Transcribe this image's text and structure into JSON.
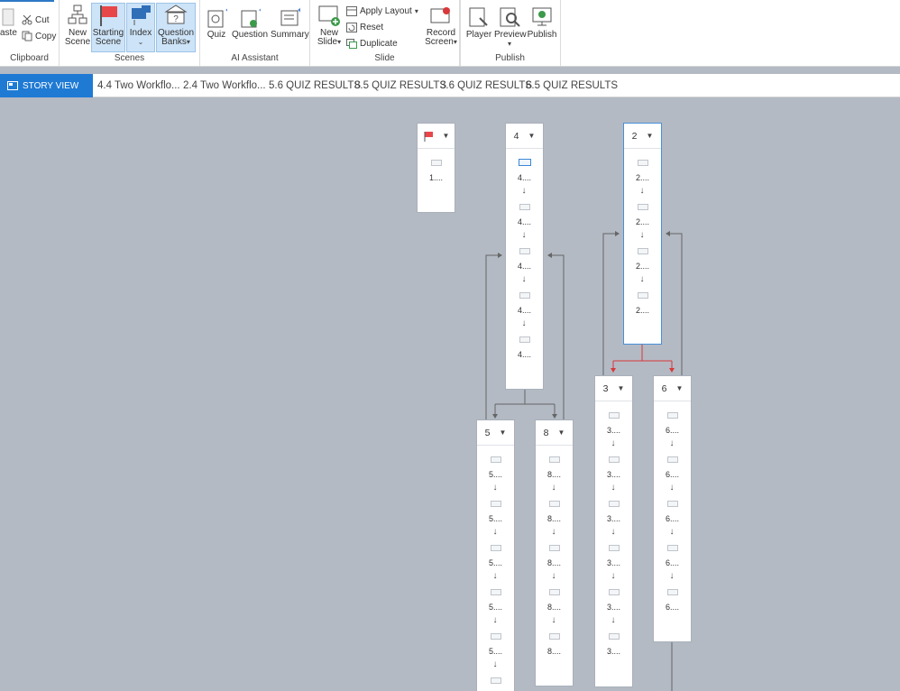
{
  "ribbon": {
    "clipboard": {
      "paste": "aste",
      "cut": "Cut",
      "copy": "Copy",
      "label": "Clipboard"
    },
    "scenes": {
      "new_scene": [
        "New",
        "Scene"
      ],
      "starting_scene": [
        "Starting",
        "Scene"
      ],
      "index": "Index",
      "question_banks": [
        "Question",
        "Banks"
      ],
      "label": "Scenes"
    },
    "ai": {
      "quiz": "Quiz",
      "question": "Question",
      "summary": "Summary",
      "label": "AI Assistant"
    },
    "slide": {
      "new_slide": [
        "New",
        "Slide"
      ],
      "apply_layout": "Apply Layout",
      "reset": "Reset",
      "duplicate": "Duplicate",
      "label": "Slide"
    },
    "record": [
      "Record",
      "Screen"
    ],
    "publish": {
      "player": "Player",
      "preview": "Preview",
      "publish": "Publish",
      "label": "Publish"
    }
  },
  "tabs": {
    "active": "STORY VIEW",
    "items": [
      "4.4 Two Workflo...",
      "2.4 Two Workflo...",
      "5.6 QUIZ RESULTS",
      "8.5 QUIZ RESULTS",
      "3.6 QUIZ RESULTS",
      "6.5 QUIZ RESULTS"
    ]
  },
  "scenes": {
    "s1": {
      "slides": [
        "1...."
      ]
    },
    "s4": {
      "title": "4",
      "slides": [
        "4....",
        "4....",
        "4....",
        "4....",
        "4...."
      ]
    },
    "s2": {
      "title": "2",
      "slides": [
        "2....",
        "2....",
        "2....",
        "2...."
      ]
    },
    "s5": {
      "title": "5",
      "slides": [
        "5....",
        "5....",
        "5....",
        "5....",
        "5...."
      ]
    },
    "s8": {
      "title": "8",
      "slides": [
        "8....",
        "8....",
        "8....",
        "8....",
        "8...."
      ]
    },
    "s3": {
      "title": "3",
      "slides": [
        "3....",
        "3....",
        "3....",
        "3....",
        "3....",
        "3...."
      ]
    },
    "s6": {
      "title": "6",
      "slides": [
        "6....",
        "6....",
        "6....",
        "6....",
        "6...."
      ]
    }
  },
  "colors": {
    "accent": "#1f7ad4",
    "canvas": "#b3bac4",
    "flag": "#e8474a",
    "link_red": "#d9383a",
    "link_gray": "#666666"
  }
}
